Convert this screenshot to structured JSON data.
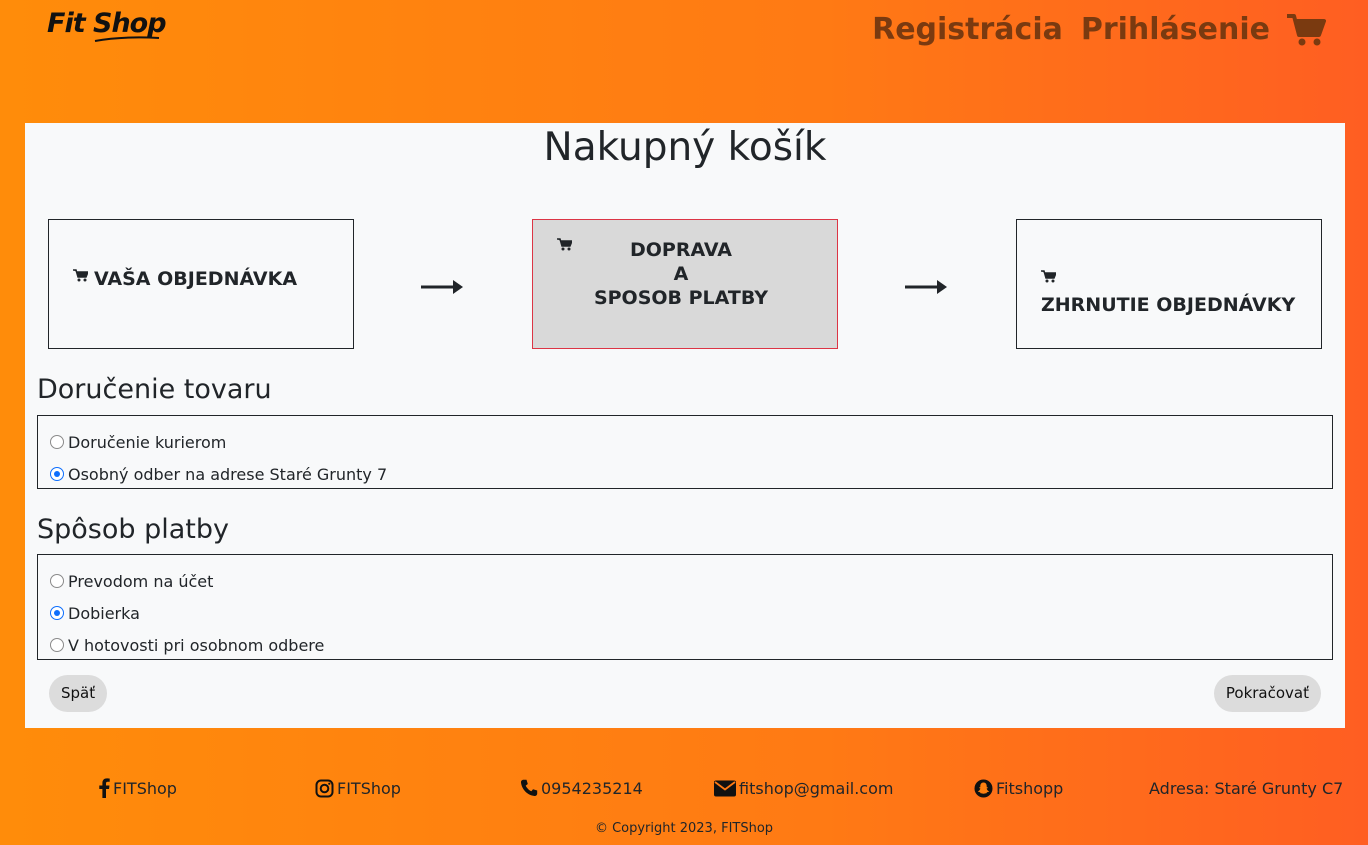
{
  "brand": {
    "logo_part1": "Fit",
    "logo_part2": "Shop"
  },
  "nav": {
    "register": "Registrácia",
    "login": "Prihlásenie",
    "cart_icon": "shopping-cart-icon"
  },
  "page": {
    "title": "Nakupný košík"
  },
  "steps": [
    {
      "label": "VAŠA OBJEDNÁVKA",
      "active": false
    },
    {
      "line1": "DOPRAVA",
      "line2": "A",
      "line3": "SPOSOB PLATBY",
      "active": true
    },
    {
      "label": "ZHRNUTIE OBJEDNÁVKY",
      "active": false
    }
  ],
  "delivery": {
    "title": "Doručenie tovaru",
    "options": [
      {
        "label": "Doručenie kurierom",
        "selected": false
      },
      {
        "label": "Osobný odber na adrese Staré Grunty 7",
        "selected": true
      }
    ]
  },
  "payment": {
    "title": "Spôsob platby",
    "options": [
      {
        "label": "Prevodom na účet",
        "selected": false
      },
      {
        "label": "Dobierka",
        "selected": true
      },
      {
        "label": "V hotovosti pri osobnom odbere",
        "selected": false
      }
    ]
  },
  "buttons": {
    "back": "Späť",
    "next": "Pokračovať"
  },
  "footer": {
    "facebook": "FITShop",
    "instagram": "FITShop",
    "phone": "0954235214",
    "email": "fitshop@gmail.com",
    "snapchat": "Fitshopp",
    "address": "Adresa: Staré Grunty C7",
    "copyright": "© Copyright 2023, FITShop"
  },
  "colors": {
    "accent_active_border": "#dc3545",
    "nav_text": "#7a3a10",
    "radio_selected": "#0d6efd"
  }
}
